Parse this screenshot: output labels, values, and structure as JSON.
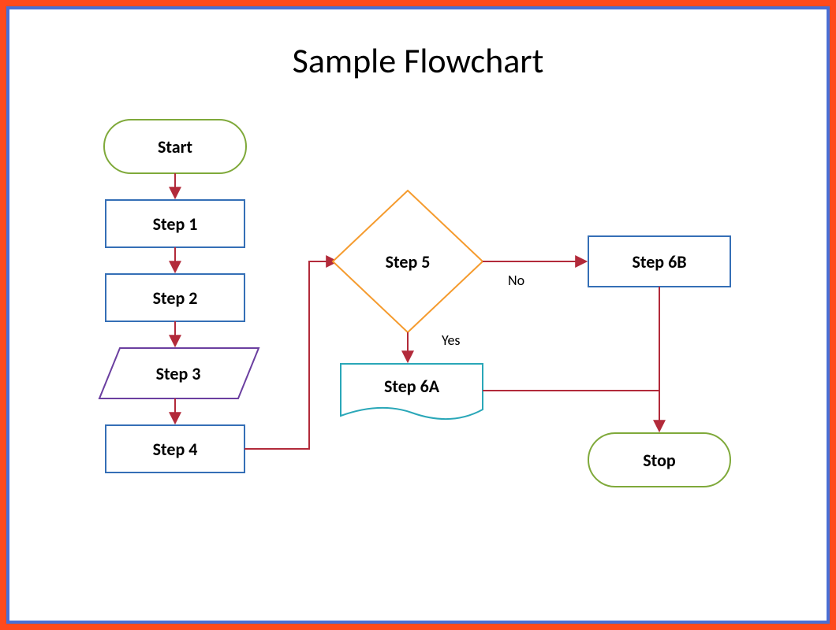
{
  "title": "Sample Flowchart",
  "nodes": {
    "start": "Start",
    "step1": "Step 1",
    "step2": "Step 2",
    "step3": "Step 3",
    "step4": "Step 4",
    "step5": "Step 5",
    "step6a": "Step 6A",
    "step6b": "Step 6B",
    "stop": "Stop"
  },
  "edges": {
    "yes": "Yes",
    "no": "No"
  },
  "colors": {
    "terminator": "#7fa93a",
    "process_blue": "#356fb6",
    "process_purple": "#6b3fa0",
    "decision": "#f59b2e",
    "doc": "#2aa7b8",
    "arrow": "#b22a3a"
  }
}
